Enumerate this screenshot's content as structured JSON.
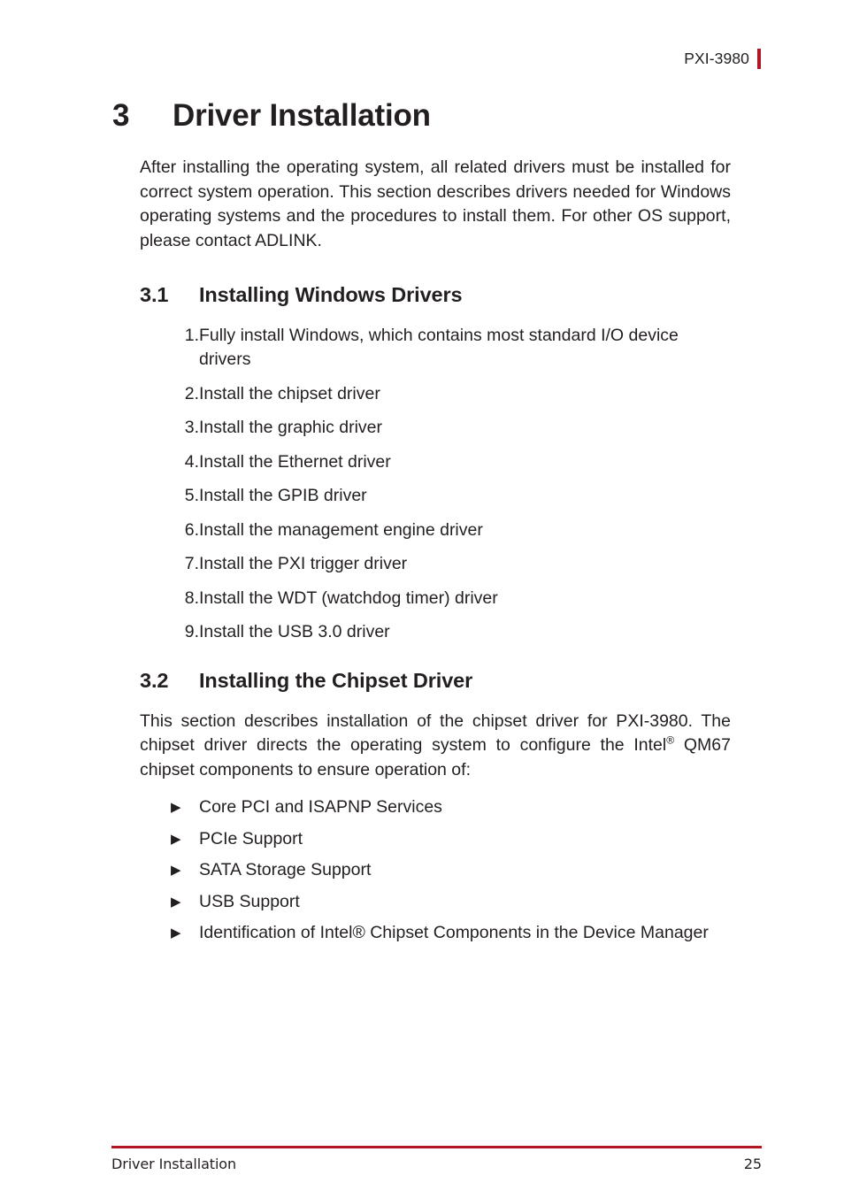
{
  "document": {
    "header_title": "PXI-3980",
    "accent_color": "#b01722",
    "text_color": "#231f20",
    "background_color": "#ffffff"
  },
  "chapter": {
    "number": "3",
    "title": "Driver Installation"
  },
  "intro_paragraph": "After installing the operating system, all related drivers must be installed for correct system operation. This section describes drivers needed for Windows operating systems and the procedures to install them. For other OS support, please contact ADLINK.",
  "section_3_1": {
    "number": "3.1",
    "title": "Installing Windows Drivers",
    "steps": [
      {
        "marker": "1.",
        "text": "Fully install Windows, which contains most standard I/O device drivers"
      },
      {
        "marker": "2.",
        "text": "Install the chipset driver"
      },
      {
        "marker": "3.",
        "text": "Install the graphic driver"
      },
      {
        "marker": "4.",
        "text": "Install the Ethernet driver"
      },
      {
        "marker": "5.",
        "text": "Install the GPIB driver"
      },
      {
        "marker": "6.",
        "text": "Install the management engine driver"
      },
      {
        "marker": "7.",
        "text": "Install the PXI trigger driver"
      },
      {
        "marker": "8.",
        "text": "Install the WDT (watchdog timer) driver"
      },
      {
        "marker": "9.",
        "text": "Install the USB 3.0 driver"
      }
    ]
  },
  "section_3_2": {
    "number": "3.2",
    "title": "Installing the Chipset Driver",
    "paragraph_part1": "This section describes installation of the chipset driver for PXI-3980. The chipset driver directs the operating system to configure the Intel",
    "paragraph_superscript": "®",
    "paragraph_part2": " QM67 chipset components to ensure operation of:",
    "bullet_marker": "▶",
    "bullets": [
      "Core PCI and ISAPNP Services",
      "PCIe Support",
      "SATA Storage Support",
      "USB Support",
      "Identification of Intel® Chipset Components in the Device Manager"
    ]
  },
  "footer": {
    "left": "Driver Installation",
    "right": "25"
  }
}
